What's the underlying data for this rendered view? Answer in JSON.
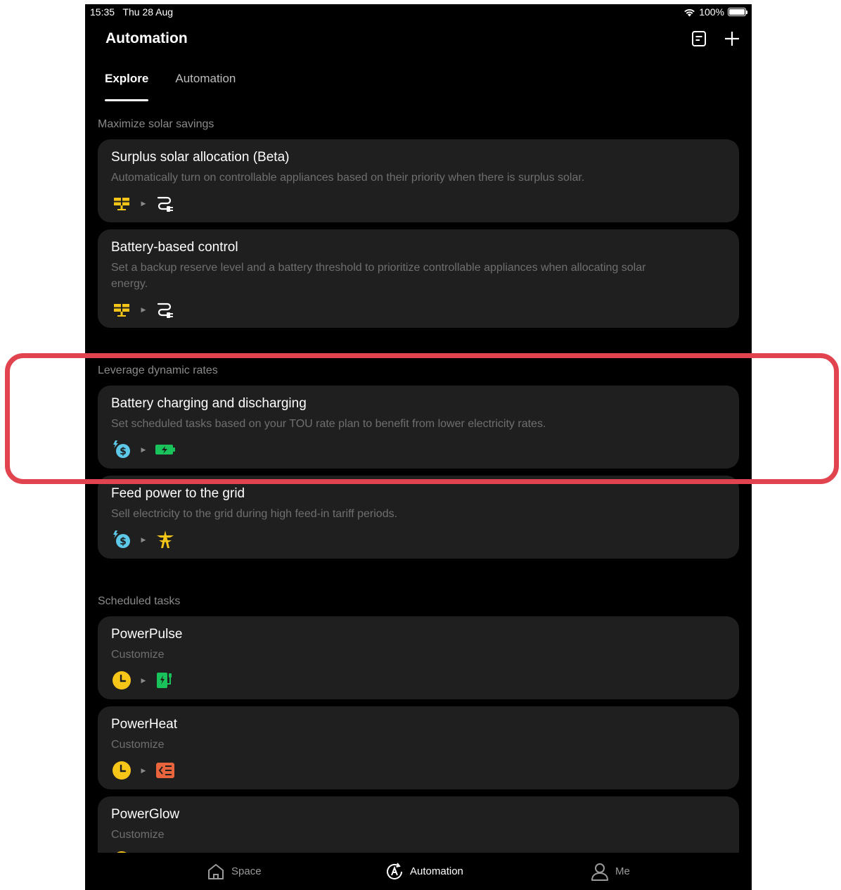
{
  "status_bar": {
    "time": "15:35",
    "date": "Thu 28 Aug",
    "battery": "100%"
  },
  "header": {
    "title": "Automation"
  },
  "tabs": [
    {
      "label": "Explore",
      "active": true
    },
    {
      "label": "Automation",
      "active": false
    }
  ],
  "sections": [
    {
      "title": "Maximize solar savings"
    },
    {
      "title": "Leverage dynamic rates"
    },
    {
      "title": "Scheduled tasks"
    }
  ],
  "cards": [
    {
      "title": "Surplus solar allocation (Beta)",
      "description": "Automatically turn on controllable appliances based on their priority when there is surplus solar.",
      "icons": [
        "solar-panel-icon",
        "plug-icon"
      ]
    },
    {
      "title": "Battery-based control",
      "description": "Set a backup reserve level and a battery threshold to prioritize controllable appliances when allocating solar energy.",
      "icons": [
        "solar-panel-icon",
        "plug-icon"
      ]
    },
    {
      "title": "Battery charging and discharging",
      "description": "Set scheduled tasks based on your TOU rate plan to benefit from lower electricity rates.",
      "icons": [
        "dollar-rate-icon",
        "battery-charging-icon"
      ]
    },
    {
      "title": "Feed power to the grid",
      "description": "Sell electricity to the grid during high feed-in tariff periods.",
      "icons": [
        "dollar-rate-icon",
        "power-tower-icon"
      ]
    },
    {
      "title": "PowerPulse",
      "description": "Customize",
      "icons": [
        "clock-icon",
        "ev-charger-icon"
      ]
    },
    {
      "title": "PowerHeat",
      "description": "Customize",
      "icons": [
        "clock-icon",
        "heater-icon"
      ]
    },
    {
      "title": "PowerGlow",
      "description": "Customize",
      "icons": [
        "clock-icon",
        "light-icon"
      ]
    }
  ],
  "bottom_nav": [
    {
      "label": "Space",
      "icon": "home-icon",
      "active": false
    },
    {
      "label": "Automation",
      "icon": "automation-icon",
      "active": true
    },
    {
      "label": "Me",
      "icon": "person-icon",
      "active": false
    }
  ],
  "colors": {
    "background": "#000000",
    "card": "#1f1f1f",
    "highlight": "#e2444f",
    "solar": "#f5c518",
    "dollar": "#5ec8e8",
    "battery": "#19c25a",
    "heater": "#e8643c"
  }
}
